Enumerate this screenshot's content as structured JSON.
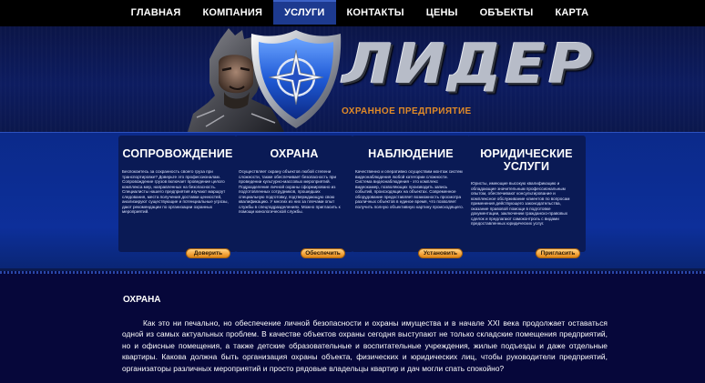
{
  "nav": {
    "items": [
      "ГЛАВНАЯ",
      "КОМПАНИЯ",
      "УСЛУГИ",
      "КОНТАКТЫ",
      "ЦЕНЫ",
      "ОБЪЕКТЫ",
      "КАРТА"
    ],
    "active": "УСЛУГИ"
  },
  "header": {
    "logo_text": "ЛИДЕР",
    "subtitle": "ОХРАННОЕ ПРЕДПРИЯТИЕ"
  },
  "services": [
    {
      "title": "СОПРОВОЖДЕНИЕ",
      "text": "Беспокоитесь за сохранность своего груза при транспортировке? Доверьте это профессионалам. Сопровождение грузов включает проведение целого комплекса мер, направленных на безопасность. Специалисты нашего предприятия изучают маршрут следования, места получения доставки ценностей, анализируют существующие и потенциальные угрозы, дают рекомендации по организации охранных мероприятий.",
      "button": "Доверить"
    },
    {
      "title": "ОХРАНА",
      "text": "Осуществляет охрану объектов любой степени сложности, также обеспечивает безопасность при проведении культурно-массовых мероприятий. Подразделение личной охраны сформировано из подготовленных сотрудников, прошедших специальную подготовку, подтверждающую свою квалификацию. У многих из них за плечами опыт службы в спецподразделениях. Можно пригласить к помощи кинологической службы.",
      "button": "Обеспечить"
    },
    {
      "title": "НАБЛЮДЕНИЕ",
      "text": "Качественно и оперативно осуществим монтаж систем видеонаблюдения любой категории сложности. Система видеонаблюдения - это комплекс видеокамер, позволяющих производить запись событий, происходящих на объектах. Современное оборудование предоставляет возможность просмотра различных объектов в единое время, что позволяет получить полную объективную картину происходящего.",
      "button": "Установить"
    },
    {
      "title": "ЮРИДИЧЕСКИЕ УСЛУГИ",
      "text": "Юристы, имеющие высокую квалификацию и обладающие значительным профессиональным опытом, обеспечивают консультирование и комплексное обслуживание клиентов по вопросам применения действующего законодательства, оказание правовой помощи в подготовке документации, заключении гражданско-правовых сделок и предлагают самоконтроль с видами предоставленных юридических услуг.",
      "button": "Пригласить"
    }
  ],
  "content": {
    "heading": "ОХРАНА",
    "paragraph": "Как это ни печально, но обеспечение личной безопасности и охраны имущества и в начале XXI века продолжает оставаться одной из самых актуальных проблем. В качестве объектов охраны сегодня выступают не только складские помещения предприятий, но и офисные помещения, а также детские образовательные и воспитательные учреждения, жилые подъезды и даже отдельные квартиры. Какова должна быть организация охраны объекта, физических и юридических лиц, чтобы руководители предприятий, организаторы различных мероприятий и просто рядовые владельцы квартир и дач могли спать спокойно?"
  },
  "colors": {
    "nav_bg": "#000000",
    "nav_active": "#1d3a8f",
    "band": "#0d2f9a",
    "panel": "#0a1a55",
    "accent": "#e08a28",
    "page_bg": "#06073a"
  },
  "icons": [
    "warrior-logo",
    "shield-compass-icon"
  ]
}
